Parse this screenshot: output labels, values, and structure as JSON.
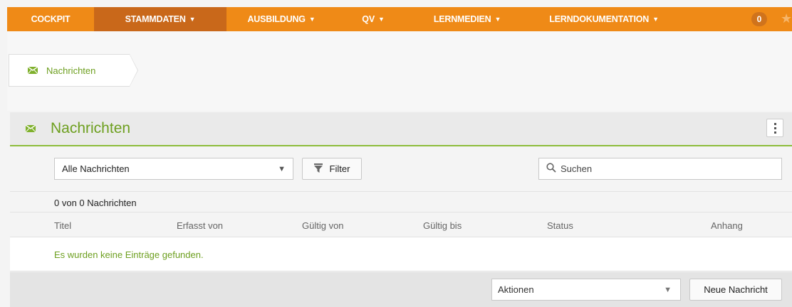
{
  "nav": {
    "items": [
      {
        "label": "COCKPIT",
        "caret": ""
      },
      {
        "label": "STAMMDATEN",
        "caret": "▼"
      },
      {
        "label": "AUSBILDUNG",
        "caret": "▼"
      },
      {
        "label": "QV",
        "caret": "▼"
      },
      {
        "label": "LERNMEDIEN",
        "caret": "▼"
      },
      {
        "label": "LERNDOKUMENTATION",
        "caret": "▼"
      }
    ],
    "badge_count": "0",
    "star_glyph": "★",
    "colors": {
      "bar": "#ef8a17",
      "active": "#c9681a"
    }
  },
  "breadcrumb": {
    "icon": "envelope-icon",
    "label": "Nachrichten"
  },
  "panel": {
    "icon": "envelope-icon",
    "title": "Nachrichten",
    "accent": "#6d9f1f"
  },
  "toolbar": {
    "filter_select_value": "Alle Nachrichten",
    "filter_button_label": "Filter",
    "search_placeholder": "Suchen"
  },
  "list": {
    "count_text": "0 von 0 Nachrichten",
    "columns": [
      "Titel",
      "Erfasst von",
      "Gültig von",
      "Gültig bis",
      "Status",
      "Anhang"
    ],
    "empty_text": "Es wurden keine Einträge gefunden."
  },
  "footer": {
    "actions_label": "Aktionen",
    "new_button_label": "Neue Nachricht"
  }
}
